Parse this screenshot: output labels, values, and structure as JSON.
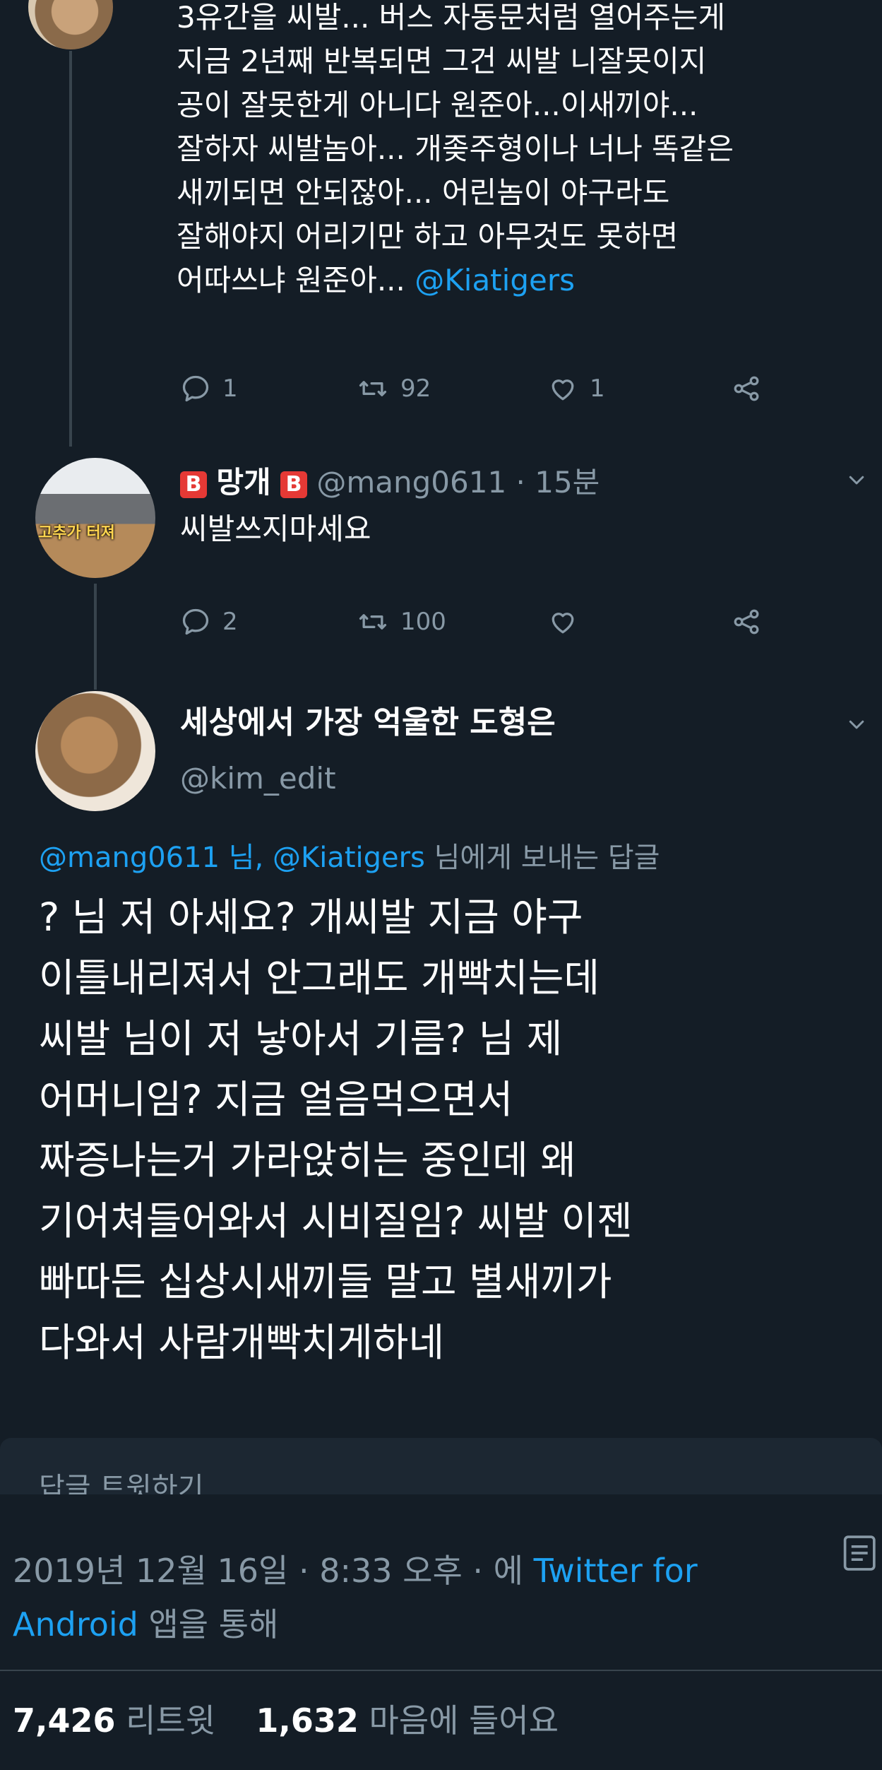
{
  "tweet1": {
    "lines": [
      "3유간을 씨발... 버스 자동문처럼 열어주는게",
      "지금 2년째 반복되면 그건 씨발 니잘못이지",
      "공이 잘못한게 아니다 원준아...이새끼야...",
      "잘하자 씨발놈아... 개좆주형이나 너나 똑같은",
      "새끼되면 안되잖아... 어린놈이 야구라도",
      "잘해야지 어리기만 하고 아무것도 못하면"
    ],
    "last_line_text": "어따쓰냐 원준아... ",
    "last_line_mention": "@Kiatigers",
    "reply_count": "1",
    "retweet_count": "92",
    "like_count": "1"
  },
  "tweet2": {
    "badge_letter": "B",
    "name": "망개",
    "handle_time": "@mang0611 · 15분",
    "avatar_caption": "고추가 터져",
    "text": "씨발쓰지마세요",
    "reply_count": "2",
    "retweet_count": "100"
  },
  "main_tweet": {
    "name": "세상에서 가장 억울한 도형은",
    "handle": "@kim_edit",
    "reply_to_link": "@mang0611 님, @Kiatigers",
    "reply_to_suffix": " 님에게 보내는 답글",
    "lines": [
      "? 님 저 아세요? 개씨발 지금 야구",
      "이틀내리져서 안그래도 개빡치는데",
      "씨발 님이 저 낳아서 기름? 님 제",
      "어머니임? 지금 얼음먹으면서",
      "짜증나는거 가라앉히는 중인데 왜",
      "기어쳐들어와서 시비질임? 씨발 이젠",
      "빠따든 십상시새끼들 말고 별새끼가",
      "다와서 사람개빡치게하네"
    ],
    "compose_placeholder": "답글 트윗하기",
    "timestamp_text": "2019년 12월 16일 · 8:33 오후 · 에 ",
    "source_link_1": "Twitter for",
    "source_link_2": "Android",
    "source_suffix": " 앱을 통해",
    "retweets_value": "7,426",
    "retweets_label": "리트윗",
    "likes_value": "1,632",
    "likes_label": "마음에 들어요"
  },
  "colors": {
    "background": "#141d26",
    "link": "#1da1f2",
    "muted": "#8899a6",
    "divider": "#38444d"
  },
  "icons": [
    "reply-icon",
    "retweet-icon",
    "like-icon",
    "share-icon",
    "chevron-down-icon",
    "analytics-icon"
  ]
}
